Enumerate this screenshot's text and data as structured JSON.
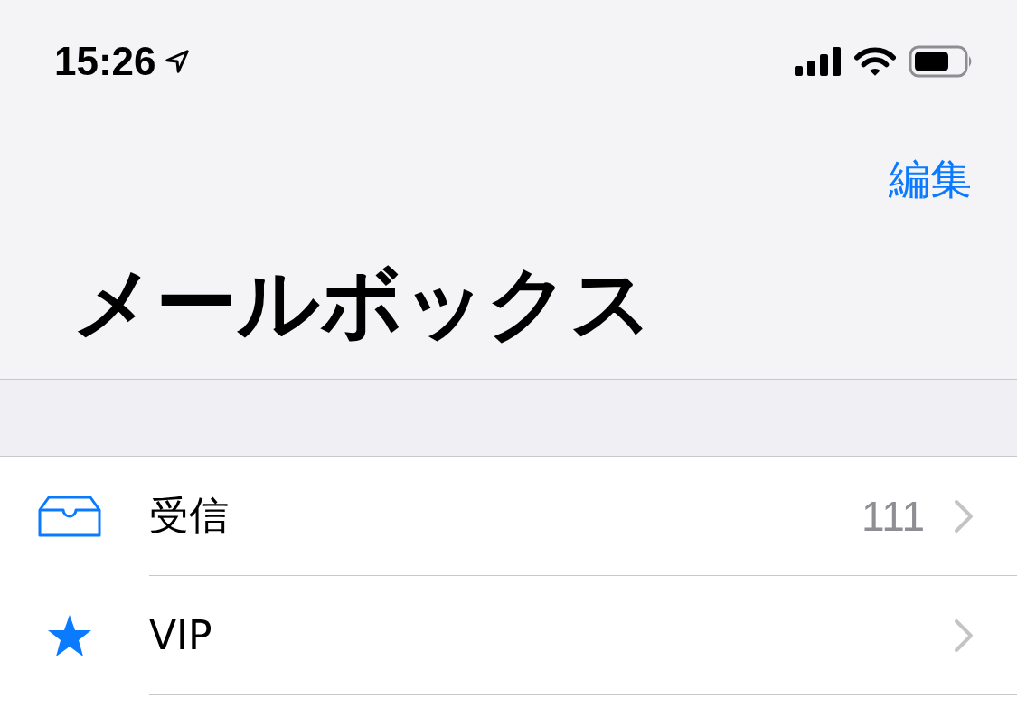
{
  "status_bar": {
    "time": "15:26"
  },
  "nav": {
    "edit_label": "編集",
    "title": "メールボックス"
  },
  "mailboxes": [
    {
      "kind": "inbox",
      "label": "受信",
      "count": "111"
    },
    {
      "kind": "star",
      "label": "VIP"
    }
  ]
}
